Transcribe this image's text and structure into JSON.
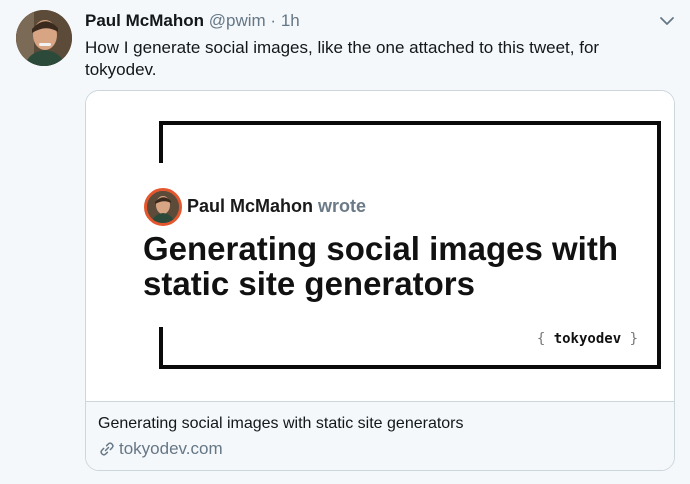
{
  "tweet": {
    "author_name": "Paul McMahon",
    "author_handle": "@pwim",
    "separator": "·",
    "time": "1h",
    "text": "How I generate social images, like the one attached to this tweet, for tokyodev."
  },
  "card": {
    "image": {
      "author": "Paul McMahon",
      "wrote": "wrote",
      "title": "Generating social images with static site generators",
      "brand_open": "{",
      "brand": "tokyodev",
      "brand_close": "}"
    },
    "title": "Generating social images with static site generators",
    "domain": "tokyodev.com"
  },
  "colors": {
    "background": "#f5f8fa",
    "muted_text": "#657786",
    "card_border": "#ccd6dd",
    "avatar_ring": "#e4572e"
  },
  "icons": {
    "caret": "chevron-down-icon",
    "link": "link-icon"
  }
}
